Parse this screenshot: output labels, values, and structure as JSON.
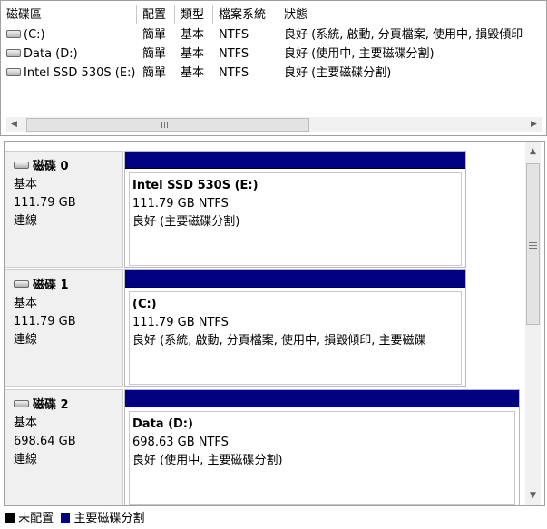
{
  "columns": [
    "磁碟區",
    "配置",
    "類型",
    "檔案系統",
    "狀態"
  ],
  "volumes": [
    {
      "name": "(C:)",
      "layout": "簡單",
      "type": "基本",
      "fs": "NTFS",
      "status": "良好 (系統, 啟動, 分頁檔案, 使用中, 損毀傾印"
    },
    {
      "name": "Data (D:)",
      "layout": "簡單",
      "type": "基本",
      "fs": "NTFS",
      "status": "良好 (使用中, 主要磁碟分割)"
    },
    {
      "name": "Intel SSD 530S (E:)",
      "layout": "簡單",
      "type": "基本",
      "fs": "NTFS",
      "status": "良好 (主要磁碟分割)"
    }
  ],
  "disks": [
    {
      "label": "磁碟 0",
      "type": "基本",
      "size": "111.79 GB",
      "state": "連線",
      "partition": {
        "name": "Intel SSD 530S  (E:)",
        "size_fs": "111.79 GB NTFS",
        "status": "良好 (主要磁碟分割)"
      }
    },
    {
      "label": "磁碟 1",
      "type": "基本",
      "size": "111.79 GB",
      "state": "連線",
      "partition": {
        "name": " (C:)",
        "size_fs": "111.79 GB NTFS",
        "status": "良好 (系統, 啟動, 分頁檔案, 使用中, 損毀傾印, 主要磁碟"
      }
    },
    {
      "label": "磁碟 2",
      "type": "基本",
      "size": "698.64 GB",
      "state": "連線",
      "partition": {
        "name": "Data  (D:)",
        "size_fs": "698.63 GB NTFS",
        "status": "良好 (使用中, 主要磁碟分割)"
      }
    }
  ],
  "legend": [
    {
      "label": "未配置",
      "color": "#000000"
    },
    {
      "label": "主要磁碟分割",
      "color": "#000080"
    }
  ],
  "icons": {
    "volume": "drive-icon",
    "disk": "disk-icon"
  }
}
